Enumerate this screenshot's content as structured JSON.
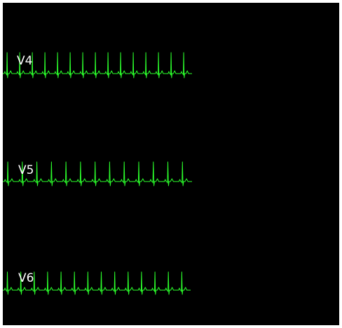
{
  "theme": {
    "panel_background": "#000000",
    "trace_color": "#2bff2b",
    "label_color": "#ffffff"
  },
  "leads": [
    {
      "label": "V4",
      "beats": 15
    },
    {
      "label": "V5",
      "beats": 13
    },
    {
      "label": "V6",
      "beats": 14
    }
  ]
}
